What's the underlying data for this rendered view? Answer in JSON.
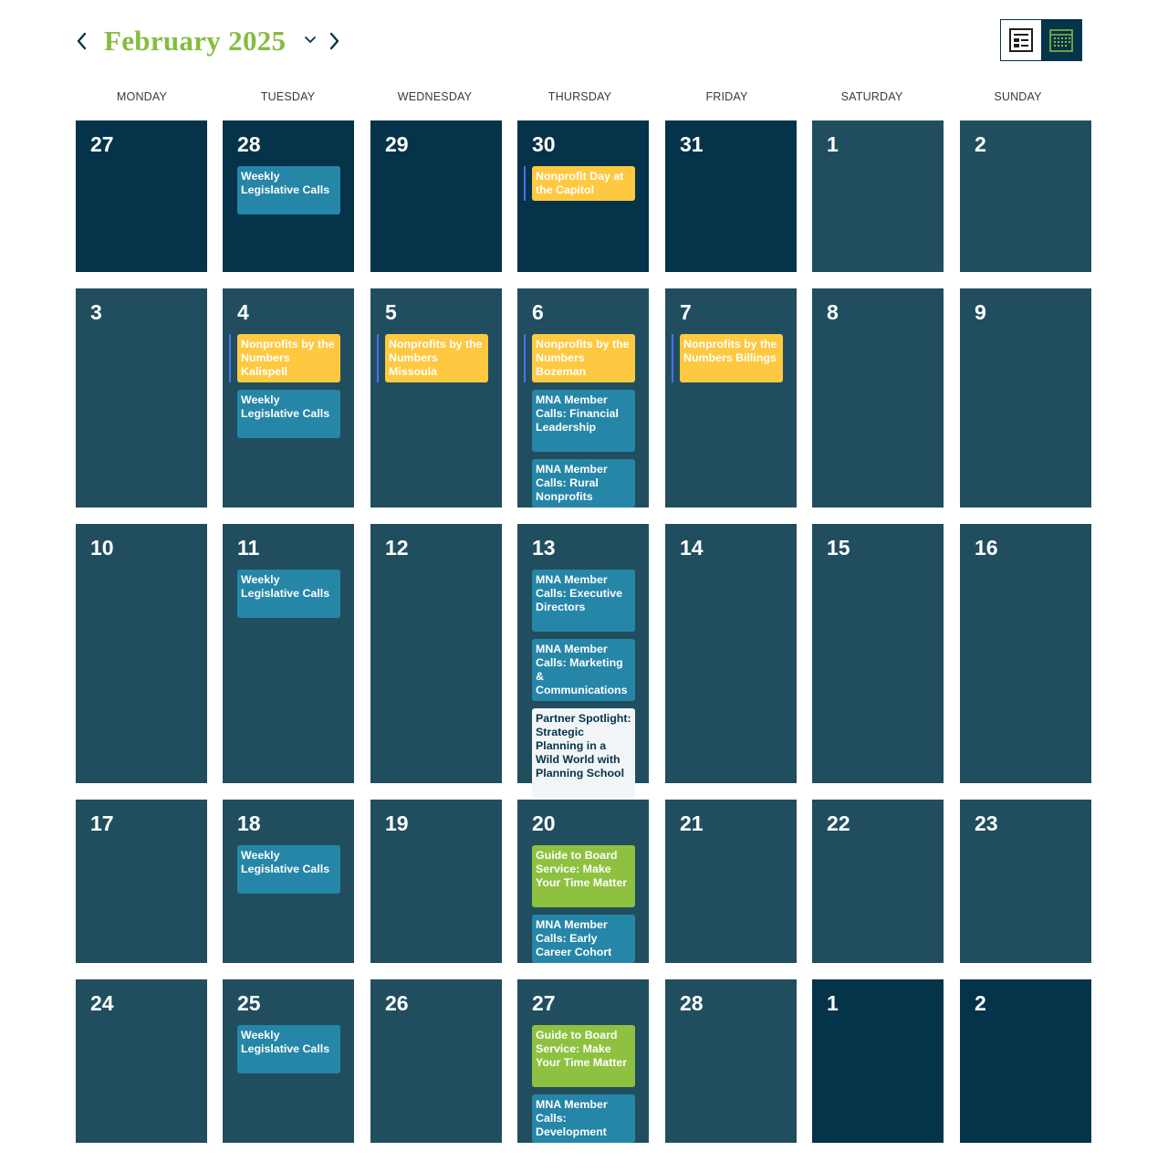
{
  "header": {
    "month_title": "February 2025",
    "prev_icon": "chevron-left-icon",
    "next_icon": "chevron-right-icon",
    "month_picker_icon": "chevron-down-icon",
    "view_list_icon": "list-view-icon",
    "view_month_icon": "calendar-grid-icon"
  },
  "colors": {
    "title": "#86bc3f",
    "outside_month_cell": "#053349",
    "current_month_cell": "#214e5e",
    "event_blue": "#2686a8",
    "event_yellow": "#fec840",
    "event_green": "#8dc13f",
    "event_white": "#f2f5f7",
    "multi_day_marker": "#4f6ff2"
  },
  "weekdays": [
    "MONDAY",
    "TUESDAY",
    "WEDNESDAY",
    "THURSDAY",
    "FRIDAY",
    "SATURDAY",
    "SUNDAY"
  ],
  "weeks": [
    {
      "days": [
        {
          "num": "27",
          "in_month": false,
          "events": []
        },
        {
          "num": "28",
          "in_month": false,
          "events": [
            {
              "title": "Weekly Legislative Calls",
              "color": "blue"
            }
          ]
        },
        {
          "num": "29",
          "in_month": false,
          "events": []
        },
        {
          "num": "30",
          "in_month": false,
          "events": [
            {
              "title": "Nonprofit Day at the Capitol",
              "color": "yellow",
              "marker": true
            }
          ]
        },
        {
          "num": "31",
          "in_month": false,
          "events": []
        },
        {
          "num": "1",
          "in_month": true,
          "events": []
        },
        {
          "num": "2",
          "in_month": true,
          "events": []
        }
      ]
    },
    {
      "days": [
        {
          "num": "3",
          "in_month": true,
          "events": []
        },
        {
          "num": "4",
          "in_month": true,
          "events": [
            {
              "title": "Nonprofits by the Numbers Kalispell",
              "color": "yellow",
              "marker": true
            },
            {
              "title": "Weekly Legislative Calls",
              "color": "blue"
            }
          ]
        },
        {
          "num": "5",
          "in_month": true,
          "events": [
            {
              "title": "Nonprofits by the Numbers Missoula",
              "color": "yellow",
              "marker": true
            }
          ]
        },
        {
          "num": "6",
          "in_month": true,
          "events": [
            {
              "title": "Nonprofits by the Numbers Bozeman",
              "color": "yellow",
              "marker": true
            },
            {
              "title": "MNA Member Calls: Financial Leadership",
              "color": "blue"
            },
            {
              "title": "MNA Member Calls: Rural Nonprofits",
              "color": "blue"
            }
          ]
        },
        {
          "num": "7",
          "in_month": true,
          "events": [
            {
              "title": "Nonprofits by the Numbers Billings",
              "color": "yellow",
              "marker": true
            }
          ]
        },
        {
          "num": "8",
          "in_month": true,
          "events": []
        },
        {
          "num": "9",
          "in_month": true,
          "events": []
        }
      ]
    },
    {
      "days": [
        {
          "num": "10",
          "in_month": true,
          "events": []
        },
        {
          "num": "11",
          "in_month": true,
          "events": [
            {
              "title": "Weekly Legislative Calls",
              "color": "blue"
            }
          ]
        },
        {
          "num": "12",
          "in_month": true,
          "events": []
        },
        {
          "num": "13",
          "in_month": true,
          "events": [
            {
              "title": "MNA Member Calls: Executive Directors",
              "color": "blue"
            },
            {
              "title": "MNA Member Calls: Marketing & Communications",
              "color": "blue"
            },
            {
              "title": "Partner Spotlight: Strategic Planning in a Wild World with Planning School",
              "color": "white"
            }
          ]
        },
        {
          "num": "14",
          "in_month": true,
          "events": []
        },
        {
          "num": "15",
          "in_month": true,
          "events": []
        },
        {
          "num": "16",
          "in_month": true,
          "events": []
        }
      ]
    },
    {
      "days": [
        {
          "num": "17",
          "in_month": true,
          "events": []
        },
        {
          "num": "18",
          "in_month": true,
          "events": [
            {
              "title": "Weekly Legislative Calls",
              "color": "blue"
            }
          ]
        },
        {
          "num": "19",
          "in_month": true,
          "events": []
        },
        {
          "num": "20",
          "in_month": true,
          "events": [
            {
              "title": "Guide to Board Service: Make Your Time Matter",
              "color": "green"
            },
            {
              "title": "MNA Member Calls: Early Career Cohort",
              "color": "blue"
            }
          ]
        },
        {
          "num": "21",
          "in_month": true,
          "events": []
        },
        {
          "num": "22",
          "in_month": true,
          "events": []
        },
        {
          "num": "23",
          "in_month": true,
          "events": []
        }
      ]
    },
    {
      "days": [
        {
          "num": "24",
          "in_month": true,
          "events": []
        },
        {
          "num": "25",
          "in_month": true,
          "events": [
            {
              "title": "Weekly Legislative Calls",
              "color": "blue"
            }
          ]
        },
        {
          "num": "26",
          "in_month": true,
          "events": []
        },
        {
          "num": "27",
          "in_month": true,
          "events": [
            {
              "title": "Guide to Board Service: Make Your Time Matter",
              "color": "green"
            },
            {
              "title": "MNA Member Calls: Development",
              "color": "blue"
            }
          ]
        },
        {
          "num": "28",
          "in_month": true,
          "events": []
        },
        {
          "num": "1",
          "in_month": false,
          "events": []
        },
        {
          "num": "2",
          "in_month": false,
          "events": []
        }
      ]
    }
  ]
}
